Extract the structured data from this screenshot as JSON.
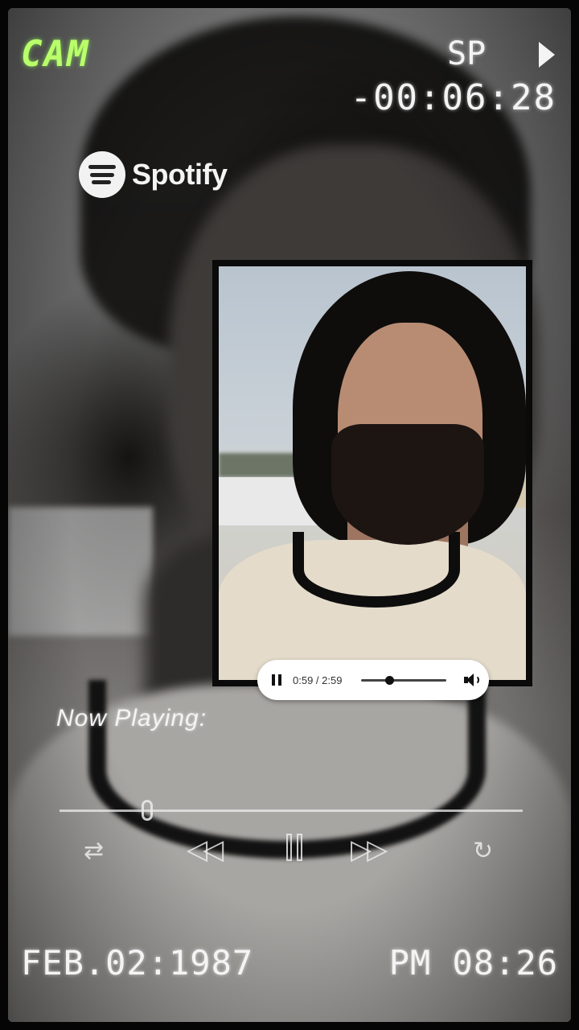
{
  "overlay": {
    "mode_label": "CAM",
    "speed_label": "SP",
    "counter": "-00:06:28",
    "date": "FEB.02:1987",
    "time": "PM 08:26"
  },
  "brand": {
    "name": "Spotify"
  },
  "mini_player": {
    "time": "0:59 / 2:59",
    "progress": 0.33
  },
  "now_playing_label": "Now Playing:",
  "transport": {
    "shuffle_icon": "shuffle-icon",
    "prev_icon": "rewind-icon",
    "pause_icon": "pause-icon",
    "next_icon": "fast-forward-icon",
    "repeat_icon": "repeat-icon",
    "progress": 0.19
  },
  "colors": {
    "cam_green": "#b9ff6a",
    "overlay_white": "#f4f4f4"
  }
}
